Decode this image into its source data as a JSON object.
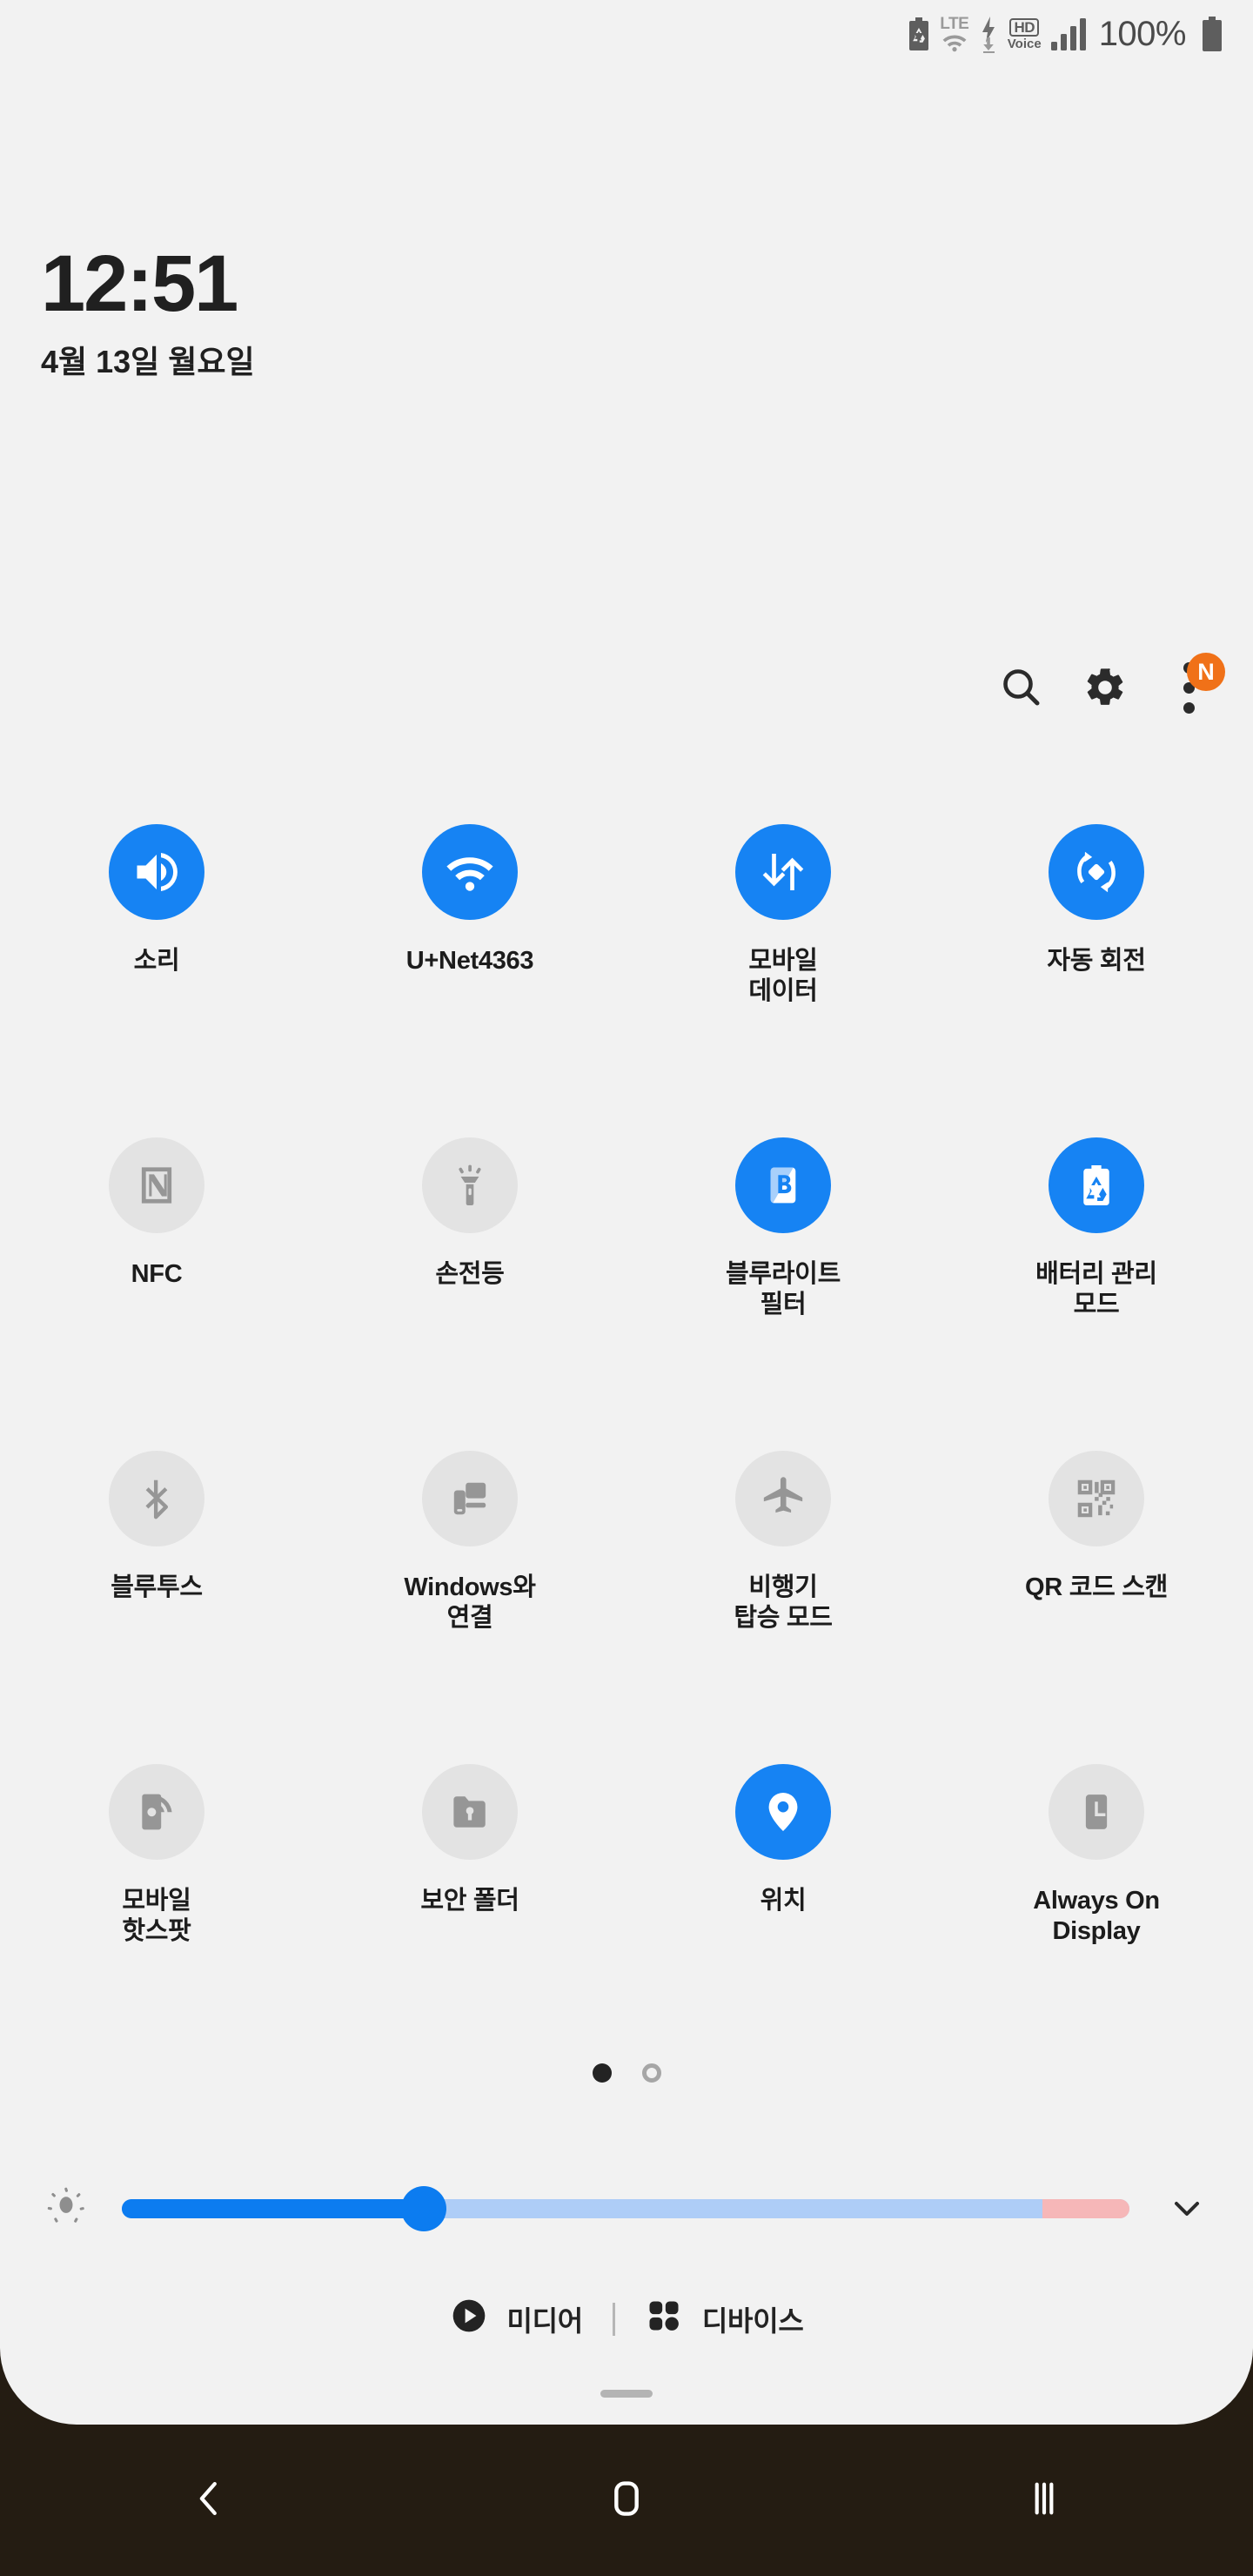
{
  "statusbar": {
    "battery_saver_icon": "battery-recycle-icon",
    "network_label": "LTE",
    "wifi_icon": "wifi-icon",
    "data_arrow_icon": "download-arrow-icon",
    "hd_label": "HD",
    "voice_label": "Voice",
    "signal_icon": "signal-bars-icon",
    "battery_percent": "100%",
    "battery_icon": "battery-full-icon"
  },
  "lockscreen": {
    "time": "12:51",
    "date": "4월 13일 월요일"
  },
  "header": {
    "search_icon": "search-icon",
    "settings_icon": "gear-icon",
    "more_icon": "three-dots-icon",
    "badge_label": "N",
    "badge_color": "#f07118"
  },
  "colors": {
    "tile_on": "#1683f3",
    "tile_off": "#e3e3e3",
    "panel_bg": "#f2f2f2",
    "navbar_bg": "#241c12",
    "slider_fill": "#0c7cf0",
    "slider_track": "#aecdf7",
    "slider_hot": "#f6b7b8"
  },
  "tiles": [
    {
      "label": "소리",
      "icon": "volume-up-icon",
      "state": "on"
    },
    {
      "label": "U+Net4363",
      "icon": "wifi-icon",
      "state": "on"
    },
    {
      "label": "모바일\n데이터",
      "icon": "mobile-data-icon",
      "state": "on"
    },
    {
      "label": "자동 회전",
      "icon": "auto-rotate-icon",
      "state": "on"
    },
    {
      "label": "NFC",
      "icon": "nfc-icon",
      "state": "off"
    },
    {
      "label": "손전등",
      "icon": "flashlight-icon",
      "state": "off"
    },
    {
      "label": "블루라이트\n필터",
      "icon": "blue-light-filter-icon",
      "state": "on"
    },
    {
      "label": "배터리 관리\n모드",
      "icon": "battery-recycle-icon",
      "state": "on"
    },
    {
      "label": "블루투스",
      "icon": "bluetooth-icon",
      "state": "off"
    },
    {
      "label": "Windows와\n연결",
      "icon": "link-to-windows-icon",
      "state": "off"
    },
    {
      "label": "비행기\n탑승 모드",
      "icon": "airplane-icon",
      "state": "off"
    },
    {
      "label": "QR 코드 스캔",
      "icon": "qr-code-icon",
      "state": "off"
    },
    {
      "label": "모바일\n핫스팟",
      "icon": "hotspot-icon",
      "state": "off"
    },
    {
      "label": "보안 폴더",
      "icon": "secure-folder-icon",
      "state": "off"
    },
    {
      "label": "위치",
      "icon": "location-pin-icon",
      "state": "on"
    },
    {
      "label": "Always On\nDisplay",
      "icon": "always-on-display-icon",
      "state": "off"
    }
  ],
  "pager": {
    "total": 2,
    "current": 1
  },
  "brightness": {
    "sun_icon": "brightness-sun-icon",
    "value_percent": 30,
    "expand_icon": "chevron-down-icon"
  },
  "bottombar": {
    "media_label": "미디어",
    "media_icon": "play-circle-icon",
    "devices_label": "디바이스",
    "devices_icon": "four-dots-grid-icon"
  },
  "navbar": {
    "back_icon": "back-chevron-icon",
    "home_icon": "home-square-icon",
    "recents_icon": "recents-bars-icon"
  }
}
